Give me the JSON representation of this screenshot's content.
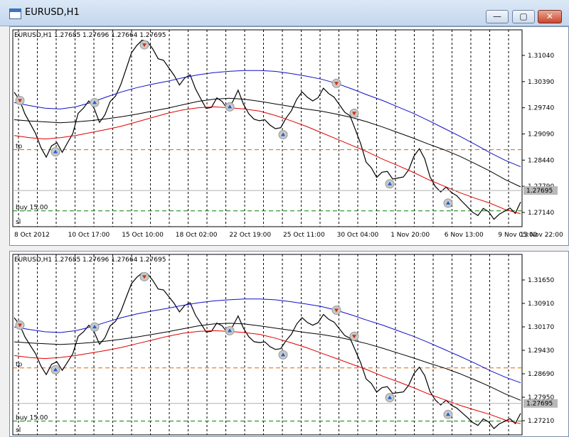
{
  "window": {
    "title": "EURUSD,H1",
    "controls": {
      "minimize": "—",
      "maximize": "▢",
      "close": "✕"
    }
  },
  "colors": {
    "price": "#000000",
    "ma_fast": "#e00000",
    "ma_mid": "#000000",
    "ma_slow": "#1010c8",
    "tp": "#e06000",
    "buy": "#008000",
    "sl": "#e06000",
    "link_buy": "#2090c0",
    "link_sell": "#e06000"
  },
  "charts": [
    {
      "header": "EURUSD,H1  1.27685 1.27696 1.27664 1.27695",
      "price_axis": [
        "1.31040",
        "1.30390",
        "1.29740",
        "1.29090",
        "1.28440",
        "1.27790",
        "1.27140"
      ],
      "current_price": "1.27695",
      "time_axis": [
        "8 Oct 2012",
        "10 Oct 17:00",
        "15 Oct 10:00",
        "18 Oct 02:00",
        "22 Oct 19:00",
        "25 Oct 11:00",
        "30 Oct 04:00",
        "1 Nov 20:00",
        "6 Nov 13:00",
        "9 Nov 05:00",
        "13 Nov 22:00"
      ],
      "labels": {
        "tp": "tp",
        "buy": "buy 15.00",
        "sl": "sl"
      },
      "ylim": [
        1.2685,
        1.3145
      ],
      "levels": {
        "tp": 1.2865,
        "buy": 1.2722,
        "sl": 1.268
      }
    },
    {
      "header": "EURUSD,H1  1.27685 1.27696 1.27664 1.27695",
      "price_axis": [
        "1.31650",
        "1.30910",
        "1.30170",
        "1.29430",
        "1.28690",
        "1.27950",
        "1.27210"
      ],
      "current_price": "1.27695",
      "time_axis": [],
      "labels": {
        "tp": "tp",
        "buy": "buy 15.00",
        "sl": "sl"
      },
      "ylim": [
        1.2685,
        1.317
      ],
      "levels": {
        "tp": 1.2865,
        "buy": 1.2722,
        "sl": 1.268
      }
    }
  ],
  "chart_data": {
    "type": "line",
    "symbol": "EURUSD,H1",
    "x_ticks": [
      "8 Oct 2012",
      "10 Oct 17:00",
      "15 Oct 10:00",
      "18 Oct 02:00",
      "22 Oct 19:00",
      "25 Oct 11:00",
      "30 Oct 04:00",
      "1 Nov 20:00",
      "6 Nov 13:00",
      "9 Nov 05:00",
      "13 Nov 22:00"
    ],
    "series": [
      {
        "values": [
          1.2995,
          1.298,
          1.295,
          1.293,
          1.29,
          1.287,
          1.285,
          1.287,
          1.288,
          1.286,
          1.2885,
          1.29,
          1.295,
          1.2965,
          1.2975,
          1.296,
          1.293,
          1.295,
          1.2975,
          1.299,
          1.302,
          1.305,
          1.309,
          1.311,
          1.3125,
          1.3115,
          1.31,
          1.308,
          1.307,
          1.3055,
          1.304,
          1.302,
          1.303,
          1.304,
          1.301,
          1.298,
          1.296,
          1.2965,
          1.299,
          1.2975,
          1.296,
          1.298,
          1.3,
          1.297,
          1.295,
          1.294,
          1.293,
          1.2935,
          1.2925,
          1.291,
          1.2915,
          1.294,
          1.296,
          1.298,
          1.3,
          1.299,
          1.2975,
          1.2985,
          1.301,
          1.3,
          1.2985,
          1.297,
          1.2955,
          1.294,
          1.291,
          1.288,
          1.284,
          1.282,
          1.28,
          1.2815,
          1.281,
          1.2795,
          1.28,
          1.2805,
          1.2815,
          1.285,
          1.287,
          1.284,
          1.28,
          1.278,
          1.277,
          1.2775,
          1.2765,
          1.276,
          1.274,
          1.273,
          1.272,
          1.2715,
          1.2725,
          1.272,
          1.2705,
          1.271,
          1.272,
          1.273,
          1.272,
          1.274
        ]
      },
      {
        "values": [
          1.2935,
          1.2932,
          1.293,
          1.2928,
          1.293,
          1.2933,
          1.2937,
          1.2942,
          1.2948,
          1.2955,
          1.2962,
          1.297,
          1.2978,
          1.2983,
          1.2985,
          1.2983,
          1.2978,
          1.2972,
          1.2966,
          1.296,
          1.2955,
          1.2948,
          1.294,
          1.293,
          1.2918,
          1.2905,
          1.2892,
          1.2878,
          1.2865,
          1.285,
          1.2833,
          1.2815,
          1.2795,
          1.2778
        ]
      },
      {
        "values": [
          1.2975,
          1.2968,
          1.2962,
          1.296,
          1.2965,
          1.2975,
          1.2988,
          1.3,
          1.301,
          1.3018,
          1.3025,
          1.3033,
          1.304,
          1.3045,
          1.3048,
          1.305,
          1.305,
          1.3048,
          1.3043,
          1.3037,
          1.303,
          1.302,
          1.3007,
          1.2993,
          1.298,
          1.2965,
          1.295,
          1.2933,
          1.2915,
          1.2897,
          1.2878,
          1.2858,
          1.284,
          1.2825
        ]
      },
      {
        "values": [
          1.2898,
          1.2893,
          1.289,
          1.2893,
          1.2898,
          1.2905,
          1.2912,
          1.292,
          1.293,
          1.294,
          1.295,
          1.2958,
          1.2963,
          1.2965,
          1.2963,
          1.296,
          1.2955,
          1.2945,
          1.2933,
          1.292,
          1.2905,
          1.289,
          1.2875,
          1.286,
          1.2843,
          1.2828,
          1.2812,
          1.2795,
          1.278,
          1.2765,
          1.2752,
          1.274,
          1.2725,
          1.2715
        ]
      }
    ],
    "ylim": [
      1.2685,
      1.3145
    ],
    "grid": true
  }
}
